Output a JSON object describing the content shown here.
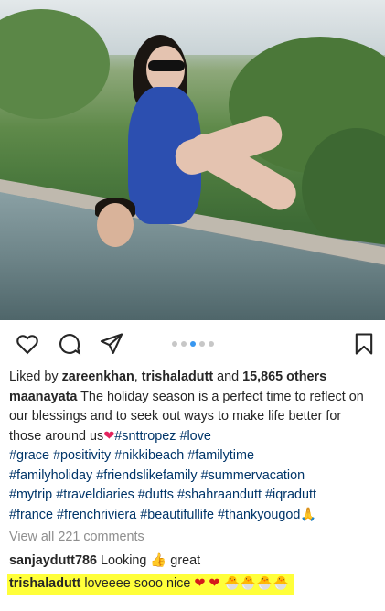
{
  "post": {
    "liked_by_prefix": "Liked by ",
    "liked_user_1": "zareenkhan",
    "liked_sep": ", ",
    "liked_user_2": "trishaladutt",
    "liked_and": " and ",
    "liked_count": "15,865 others",
    "author": "maanayata",
    "caption_text": " The holiday season is a perfect time to reflect on our blessings and to seek out ways to make life better for those around us",
    "caption_heart": "❤",
    "hashtags_line1": [
      "#snttropez",
      "#love"
    ],
    "hashtags_line2": [
      "#grace",
      "#positivity",
      "#nikkibeach",
      "#familytime"
    ],
    "hashtags_line3": [
      "#familyholiday",
      "#friendslikefamily",
      "#summervacation"
    ],
    "hashtags_line4": [
      "#mytrip",
      "#traveldiaries",
      "#dutts",
      "#shahraandutt",
      "#iqradutt"
    ],
    "hashtags_line5": [
      "#france",
      "#frenchriviera",
      "#beautifullife",
      "#thankyougod"
    ],
    "pray_emoji": "🙏",
    "view_all": "View all 221 comments",
    "carousel": {
      "total": 5,
      "active": 2
    }
  },
  "comments": [
    {
      "user": "sanjaydutt786",
      "text": " Looking ",
      "emoji": "👍",
      "text_after": " great"
    },
    {
      "user": "trishaladutt",
      "text": " loveeee sooo nice ",
      "emoji": "❤ ❤ 🐣🐣🐣🐣"
    }
  ],
  "icons": {
    "like": "heart-icon",
    "comment": "comment-icon",
    "share": "share-icon",
    "save": "bookmark-icon"
  },
  "colors": {
    "link_blue": "#003569",
    "carousel_active": "#3897f0",
    "highlight": "#ffff3a",
    "swimsuit": "#2c4fb0"
  }
}
